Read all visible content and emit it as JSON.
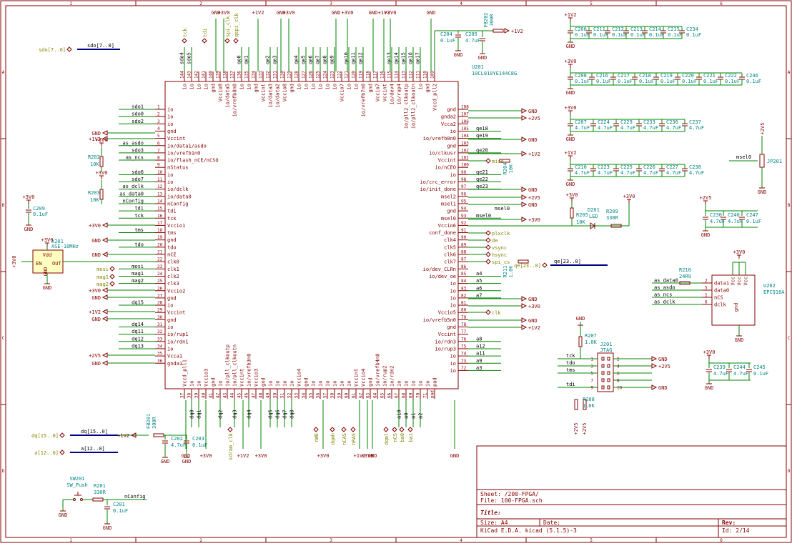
{
  "schematic": {
    "sheet_name": "Sheet: /200-FPGA/",
    "file_name": "File: 100-FPGA.sch",
    "title_label": "Title:",
    "size": "Size: A4",
    "date": "Date:",
    "rev": "Rev:",
    "tool": "KiCad E.D.A.  kicad (5.1.5)-3",
    "sheet_id": "Id: 2/14"
  },
  "border": {
    "cols": [
      "1",
      "2",
      "3",
      "4",
      "5",
      "6"
    ],
    "rows": [
      "A",
      "B",
      "C",
      "D"
    ]
  },
  "fpga": {
    "ref": "U201",
    "value": "10CL010YE144C8G",
    "left_pins": [
      {
        "num": "1",
        "name": "io",
        "net": "sdo1"
      },
      {
        "num": "2",
        "name": "io",
        "net": "sdo0"
      },
      {
        "num": "3",
        "name": "io",
        "net": "sdo2"
      },
      {
        "num": "4",
        "name": "gnd",
        "net": ""
      },
      {
        "num": "5",
        "name": "Vccint",
        "net": ""
      },
      {
        "num": "6",
        "name": "io/data1/asdo",
        "net": "as_asdo"
      },
      {
        "num": "7",
        "name": "io/vrefb1n0",
        "net": "sdo3"
      },
      {
        "num": "8",
        "name": "io/flash_nCE/nCSO",
        "net": "as_ncs"
      },
      {
        "num": "9",
        "name": "nStatus",
        "net": ""
      },
      {
        "num": "10",
        "name": "io",
        "net": "sdo6"
      },
      {
        "num": "11",
        "name": "io",
        "net": "sdo7"
      },
      {
        "num": "12",
        "name": "io/dclk",
        "net": "as_dclk"
      },
      {
        "num": "13",
        "name": "io/data0",
        "net": "as_data0"
      },
      {
        "num": "14",
        "name": "nConfig",
        "net": "nConfig"
      },
      {
        "num": "15",
        "name": "tdi",
        "net": "tdi"
      },
      {
        "num": "16",
        "name": "tck",
        "net": "tck"
      },
      {
        "num": "17",
        "name": "Vccio1",
        "net": ""
      },
      {
        "num": "18",
        "name": "tms",
        "net": "tms"
      },
      {
        "num": "19",
        "name": "gnd",
        "net": ""
      },
      {
        "num": "20",
        "name": "tdo",
        "net": "tdo"
      },
      {
        "num": "21",
        "name": "nCE",
        "net": ""
      },
      {
        "num": "22",
        "name": "clk0",
        "net": ""
      },
      {
        "num": "23",
        "name": "clk1",
        "net": "mosi"
      },
      {
        "num": "24",
        "name": "clk2",
        "net": "mag1"
      },
      {
        "num": "25",
        "name": "clk3",
        "net": "mag2"
      },
      {
        "num": "26",
        "name": "Vccio2",
        "net": ""
      },
      {
        "num": "27",
        "name": "gnd",
        "net": ""
      },
      {
        "num": "28",
        "name": "io",
        "net": "dq15"
      },
      {
        "num": "29",
        "name": "Vccint",
        "net": ""
      },
      {
        "num": "30",
        "name": "gnd",
        "net": ""
      },
      {
        "num": "31",
        "name": "io",
        "net": "dq14"
      },
      {
        "num": "32",
        "name": "io/rup1",
        "net": "dq11"
      },
      {
        "num": "33",
        "name": "io/rdn1",
        "net": "dq12"
      },
      {
        "num": "34",
        "name": "io",
        "net": "dq13"
      },
      {
        "num": "35",
        "name": "Vcca1",
        "net": ""
      },
      {
        "num": "36",
        "name": "gnda1",
        "net": ""
      }
    ],
    "right_pins": [
      {
        "num": "108",
        "name": "gnd",
        "net": ""
      },
      {
        "num": "107",
        "name": "gnda2",
        "net": ""
      },
      {
        "num": "106",
        "name": "Vcca2",
        "net": ""
      },
      {
        "num": "105",
        "name": "io",
        "net": "qe18"
      },
      {
        "num": "104",
        "name": "io/vrefb8n0",
        "net": "qe19"
      },
      {
        "num": "103",
        "name": "gnd",
        "net": ""
      },
      {
        "num": "102",
        "name": "io/clkusr",
        "net": "qe20"
      },
      {
        "num": "101",
        "name": "Vccint",
        "net": ""
      },
      {
        "num": "100",
        "name": "io/nCEO",
        "net": ""
      },
      {
        "num": "99",
        "name": "io",
        "net": "qe21"
      },
      {
        "num": "98",
        "name": "io/crc_error",
        "net": "qe22"
      },
      {
        "num": "97",
        "name": "io/init_done",
        "net": "qe23"
      },
      {
        "num": "96",
        "name": "msel2",
        "net": ""
      },
      {
        "num": "95",
        "name": "msel1",
        "net": ""
      },
      {
        "num": "94",
        "name": "gnd",
        "net": ""
      },
      {
        "num": "93",
        "name": "msel0",
        "net": "msel0"
      },
      {
        "num": "92",
        "name": "Vccio6",
        "net": ""
      },
      {
        "num": "91",
        "name": "conf_done",
        "net": ""
      },
      {
        "num": "90",
        "name": "clk4",
        "net": ""
      },
      {
        "num": "89",
        "name": "clk5",
        "net": ""
      },
      {
        "num": "88",
        "name": "clk6",
        "net": ""
      },
      {
        "num": "87",
        "name": "clk7",
        "net": ""
      },
      {
        "num": "86",
        "name": "io/dev_CLRn",
        "net": ""
      },
      {
        "num": "85",
        "name": "io/dev_oe",
        "net": "a4"
      },
      {
        "num": "84",
        "name": "io",
        "net": "a5"
      },
      {
        "num": "83",
        "name": "io",
        "net": "a6"
      },
      {
        "num": "82",
        "name": "io",
        "net": "a7"
      },
      {
        "num": "81",
        "name": "io",
        "net": ""
      },
      {
        "num": "80",
        "name": "Vccio5",
        "net": ""
      },
      {
        "num": "79",
        "name": "io/vrefb5n0",
        "net": ""
      },
      {
        "num": "78",
        "name": "gnd",
        "net": ""
      },
      {
        "num": "77",
        "name": "Vccint",
        "net": ""
      },
      {
        "num": "76",
        "name": "io/rdn3",
        "net": "a8"
      },
      {
        "num": "75",
        "name": "io/rup3",
        "net": "a12"
      },
      {
        "num": "74",
        "name": "io",
        "net": "a11"
      },
      {
        "num": "73",
        "name": "io",
        "net": "a9"
      },
      {
        "num": "72",
        "name": "io",
        "net": "a3"
      }
    ],
    "top_pins": [
      {
        "num": "144",
        "name": "io",
        "net": "sdo4"
      },
      {
        "num": "143",
        "name": "io",
        "net": "sdo5"
      },
      {
        "num": "142",
        "name": "io",
        "net": ""
      },
      {
        "num": "141",
        "name": "io",
        "net": ""
      },
      {
        "num": "140",
        "name": "gnd",
        "net": ""
      },
      {
        "num": "139",
        "name": "Vccio8",
        "net": ""
      },
      {
        "num": "138",
        "name": "io/data5",
        "net": ""
      },
      {
        "num": "137",
        "name": "io/vrefb8n0",
        "net": ""
      },
      {
        "num": "136",
        "name": "io",
        "net": "qe0"
      },
      {
        "num": "135",
        "name": "io",
        "net": "qe1"
      },
      {
        "num": "134",
        "name": "gnd",
        "net": ""
      },
      {
        "num": "133",
        "name": "Vccint",
        "net": ""
      },
      {
        "num": "132",
        "name": "io/data3",
        "net": "qe2"
      },
      {
        "num": "131",
        "name": "io/data2",
        "net": "qe3"
      },
      {
        "num": "130",
        "name": "Vccio8",
        "net": ""
      },
      {
        "num": "129",
        "name": "gnd",
        "net": ""
      },
      {
        "num": "128",
        "name": "io",
        "net": "qe4"
      },
      {
        "num": "127",
        "name": "io",
        "net": "qe5"
      },
      {
        "num": "126",
        "name": "io",
        "net": "qe6"
      },
      {
        "num": "125",
        "name": "io",
        "net": "qe7"
      },
      {
        "num": "124",
        "name": "io",
        "net": "qe8"
      },
      {
        "num": "123",
        "name": "io",
        "net": "qe9"
      },
      {
        "num": "122",
        "name": "Vccio7",
        "net": ""
      },
      {
        "num": "121",
        "name": "io",
        "net": "qe10"
      },
      {
        "num": "120",
        "name": "io",
        "net": "qe11"
      },
      {
        "num": "119",
        "name": "io/vrefb7n0",
        "net": "qe12"
      },
      {
        "num": "118",
        "name": "gnd",
        "net": ""
      },
      {
        "num": "117",
        "name": "Vccio7",
        "net": ""
      },
      {
        "num": "116",
        "name": "Vccint",
        "net": ""
      },
      {
        "num": "115",
        "name": "io/dev4",
        "net": "qe13"
      },
      {
        "num": "114",
        "name": "io/rup4",
        "net": "qe14"
      },
      {
        "num": "113",
        "name": "io/pll2_clkoutp",
        "net": "qe15"
      },
      {
        "num": "112",
        "name": "io/pll2_clkoutn",
        "net": "qe16"
      },
      {
        "num": "111",
        "name": "io",
        "net": "qe17"
      },
      {
        "num": "110",
        "name": "gnd",
        "net": ""
      },
      {
        "num": "109",
        "name": "Vccd_pll2",
        "net": ""
      }
    ],
    "bottom_pins": [
      {
        "num": "37",
        "name": "Vccd_pll1",
        "net": ""
      },
      {
        "num": "38",
        "name": "io",
        "net": "dq0"
      },
      {
        "num": "39",
        "name": "io",
        "net": "dq1"
      },
      {
        "num": "40",
        "name": "Vccio3",
        "net": ""
      },
      {
        "num": "41",
        "name": "gnd",
        "net": ""
      },
      {
        "num": "42",
        "name": "io",
        "net": "dq2"
      },
      {
        "num": "43",
        "name": "io/pll_clkoutp",
        "net": ""
      },
      {
        "num": "44",
        "name": "io/pll_clkoutn",
        "net": "dq3"
      },
      {
        "num": "45",
        "name": "Vccint",
        "net": ""
      },
      {
        "num": "46",
        "name": "io/vrefb3n0",
        "net": "dq4"
      },
      {
        "num": "47",
        "name": "Vccio3",
        "net": ""
      },
      {
        "num": "48",
        "name": "gnd",
        "net": ""
      },
      {
        "num": "49",
        "name": "io",
        "net": "dq5"
      },
      {
        "num": "50",
        "name": "io",
        "net": "dq6"
      },
      {
        "num": "51",
        "name": "io",
        "net": "dq7"
      },
      {
        "num": "52",
        "name": "io",
        "net": "dq8"
      },
      {
        "num": "53",
        "name": "Vccio4",
        "net": ""
      },
      {
        "num": "54",
        "name": "gnd",
        "net": ""
      },
      {
        "num": "55",
        "name": "io",
        "net": ""
      },
      {
        "num": "56",
        "name": "io",
        "net": ""
      },
      {
        "num": "57",
        "name": "io",
        "net": ""
      },
      {
        "num": "58",
        "name": "io",
        "net": ""
      },
      {
        "num": "59",
        "name": "io",
        "net": ""
      },
      {
        "num": "60",
        "name": "io",
        "net": ""
      },
      {
        "num": "61",
        "name": "Vccint",
        "net": ""
      },
      {
        "num": "62",
        "name": "Vccio4",
        "net": ""
      },
      {
        "num": "63",
        "name": "gnd",
        "net": ""
      },
      {
        "num": "64",
        "name": "io/vrefb4n0",
        "net": ""
      },
      {
        "num": "65",
        "name": "io/rup2",
        "net": ""
      },
      {
        "num": "66",
        "name": "io/rdn2",
        "net": ""
      },
      {
        "num": "67",
        "name": "io",
        "net": "a10"
      },
      {
        "num": "68",
        "name": "io",
        "net": "a0"
      },
      {
        "num": "69",
        "name": "io",
        "net": "a1"
      },
      {
        "num": "70",
        "name": "io",
        "net": "a2"
      },
      {
        "num": "71",
        "name": "io",
        "net": ""
      },
      {
        "num": "pad",
        "name": "pad",
        "net": ""
      }
    ],
    "top_hlabels": [
      "tck",
      "tdi",
      "spi_clk",
      "qspi_clk"
    ],
    "bottom_hlabels": [
      "sdram_clk",
      "nWE",
      "dqmh",
      "nCAS",
      "nRAS",
      "dqml",
      "nCS",
      "ba0",
      "ba1"
    ]
  },
  "buses": [
    {
      "name": "sdo[7..0]",
      "label": "sdo[7..0]"
    },
    {
      "name": "dq[15..0]",
      "label": "dq[15..0]"
    },
    {
      "name": "a[12..0]",
      "label": "a[12..0]"
    },
    {
      "name": "qe[23..0]",
      "label": "qe[23..0]"
    }
  ],
  "power": {
    "gnd": "GND",
    "v12": "+1V2",
    "v25": "+2V5",
    "v30": "+3V0"
  },
  "right_hlabels": [
    "miso",
    "plxclk",
    "de",
    "vsync",
    "hsync",
    "spi_cs",
    "clk"
  ],
  "osc": {
    "ref": "X201",
    "value": "ASE-10MHz",
    "pins": [
      "Vdd",
      "EN",
      "GND",
      "OUT"
    ]
  },
  "parts": {
    "c209": {
      "ref": "C209",
      "value": "0.1uF"
    },
    "r202": {
      "ref": "R202",
      "value": "10K"
    },
    "r203": {
      "ref": "R203",
      "value": "10K"
    },
    "r204": {
      "ref": "R204",
      "value": "10K"
    },
    "fb201": {
      "ref": "FB201",
      "value": "300R"
    },
    "c202": {
      "ref": "C202",
      "value": "4.7uF"
    },
    "c203": {
      "ref": "C203",
      "value": "0.1uF"
    },
    "fb202": {
      "ref": "FB202",
      "value": "300R"
    },
    "c204": {
      "ref": "C204",
      "value": "0.1uF"
    },
    "c205": {
      "ref": "C205",
      "value": "4.7uF"
    },
    "sw201": {
      "ref": "SW201",
      "value": "SW_Push"
    },
    "r201": {
      "ref": "R201",
      "value": "330R"
    },
    "c201": {
      "ref": "C201",
      "value": "0.1uF"
    },
    "r211": {
      "ref": "R211",
      "value": "1.0K"
    },
    "d201": {
      "ref": "D201",
      "value": "LED"
    },
    "r205": {
      "ref": "R205",
      "value": "10K"
    },
    "r209": {
      "ref": "R209",
      "value": "330R"
    },
    "r210": {
      "ref": "R210",
      "value": "24R9"
    },
    "u202": {
      "ref": "U202",
      "value": "EPCQ16A"
    },
    "r207": {
      "ref": "R207",
      "value": "1.0K"
    },
    "j201": {
      "ref": "J201",
      "value": "JTAG"
    },
    "r208": {
      "ref": "R208",
      "value": "1.0K"
    },
    "r206": {
      "ref": "R206",
      "value": "1.0K"
    },
    "jp201": {
      "ref": "JP201",
      "value": ""
    },
    "c245": {
      "ref": "C245",
      "value": "0.1uF"
    },
    "c247": {
      "ref": "C247",
      "value": "0.1uF"
    }
  },
  "cap_banks": [
    {
      "refs": [
        "C206",
        "C211",
        "C212",
        "C213",
        "C214",
        "C215",
        "C234"
      ],
      "values": [
        "0.1uF",
        "0.1uF",
        "0.1uF",
        "0.1uF",
        "0.1uF",
        "0.1uF",
        "0.1uF"
      ],
      "rail": "+1V2"
    },
    {
      "refs": [
        "C208",
        "C216",
        "C217",
        "C218",
        "C219",
        "C220",
        "C221",
        "C222",
        "C246"
      ],
      "values": [
        "0.1uF",
        "0.1uF",
        "0.1uF",
        "0.1uF",
        "0.1uF",
        "0.1uF",
        "0.1uF",
        "0.1uF",
        "0.1uF"
      ],
      "rail": "+3V0"
    },
    {
      "refs": [
        "C207",
        "C224",
        "C229",
        "C233",
        "C236",
        "C237"
      ],
      "values": [
        "4.7uF",
        "4.7uF",
        "4.7uF",
        "4.7uF",
        "4.7uF",
        "4.7uF"
      ],
      "rail": "+3V0"
    },
    {
      "refs": [
        "C210",
        "C223",
        "C225",
        "C226",
        "C227",
        "C238"
      ],
      "values": [
        "4.7uF",
        "4.7uF",
        "4.7uF",
        "4.7uF",
        "4.7uF",
        "4.7uF"
      ],
      "rail": "+1V2"
    }
  ],
  "small_caps": {
    "c230": {
      "ref": "C230",
      "value": "4.7uF"
    },
    "c240": {
      "ref": "C240",
      "value": "4.7uF"
    },
    "c239": {
      "ref": "C239",
      "value": "4.7uF"
    },
    "c244": {
      "ref": "C244",
      "value": "4.7uF"
    }
  },
  "u202_pins": [
    {
      "num": "2",
      "name": "data1",
      "net": "as_data0"
    },
    {
      "num": "5",
      "name": "data0",
      "net": "as_asdo"
    },
    {
      "num": "1",
      "name": "nCS",
      "net": "as_ncs"
    },
    {
      "num": "6",
      "name": "dclk",
      "net": "as_dclk"
    }
  ],
  "jtag_nets": [
    "tck",
    "tdo",
    "tms",
    "tdi"
  ],
  "misc_labels": {
    "nconfig": "nConfig",
    "msel0": "msel0",
    "vcc": "Vcc",
    "gnd_pin": "gnd"
  }
}
